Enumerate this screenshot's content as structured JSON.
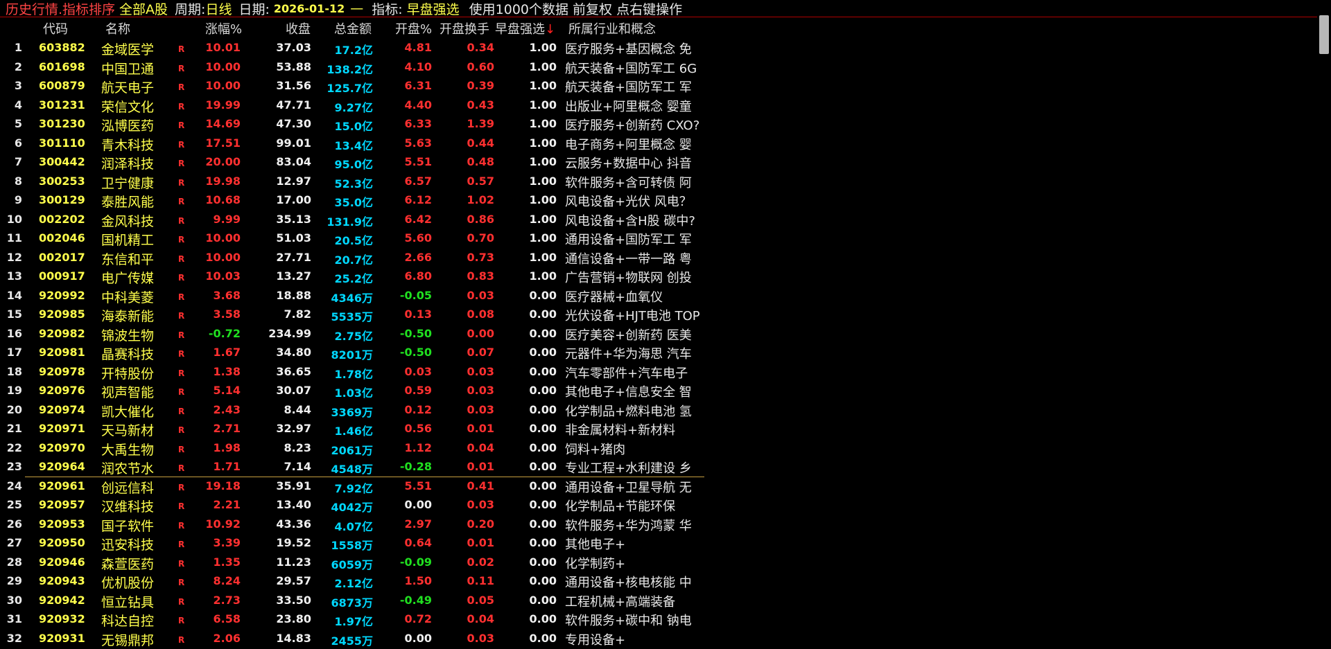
{
  "titlebar": {
    "title": "历史行情.指标排序",
    "market": "全部A股",
    "period_label": "周期:",
    "period": "日线",
    "date_label": "日期:",
    "date": "2026-01-12",
    "dash": "—",
    "indicator_label": "指标:",
    "indicator": "早盘强选",
    "note": "使用1000个数据 前复权 点右键操作"
  },
  "columns": {
    "code": "代码",
    "name": "名称",
    "chg": "涨幅%",
    "close": "收盘",
    "amount": "总金额",
    "open": "开盘%",
    "turnover": "开盘换手",
    "early": "早盘强选",
    "sort_arrow": "↓",
    "industry": "所属行业和概念"
  },
  "colors": {
    "up": "#ff3030",
    "down": "#20e020",
    "flat": "#f0f0f0",
    "code": "#ffff4c",
    "amount": "#00d8ff"
  },
  "rows": [
    {
      "idx": "1",
      "code": "603882",
      "name": "金域医学",
      "r": "R",
      "chg": "10.01",
      "chg_dir": "up",
      "close": "37.03",
      "amount": "17.2亿",
      "open": "4.81",
      "open_dir": "up",
      "turnover": "0.34",
      "early": "1.00",
      "industry": "医疗服务+基因概念 免"
    },
    {
      "idx": "2",
      "code": "601698",
      "name": "中国卫通",
      "r": "R",
      "chg": "10.00",
      "chg_dir": "up",
      "close": "53.88",
      "amount": "138.2亿",
      "open": "4.10",
      "open_dir": "up",
      "turnover": "0.60",
      "early": "1.00",
      "industry": "航天装备+国防军工 6G"
    },
    {
      "idx": "3",
      "code": "600879",
      "name": "航天电子",
      "r": "R",
      "chg": "10.00",
      "chg_dir": "up",
      "close": "31.56",
      "amount": "125.7亿",
      "open": "6.31",
      "open_dir": "up",
      "turnover": "0.39",
      "early": "1.00",
      "industry": "航天装备+国防军工 军"
    },
    {
      "idx": "4",
      "code": "301231",
      "name": "荣信文化",
      "r": "R",
      "chg": "19.99",
      "chg_dir": "up",
      "close": "47.71",
      "amount": "9.27亿",
      "open": "4.40",
      "open_dir": "up",
      "turnover": "0.43",
      "early": "1.00",
      "industry": "出版业+阿里概念 婴童"
    },
    {
      "idx": "5",
      "code": "301230",
      "name": "泓博医药",
      "r": "R",
      "chg": "14.69",
      "chg_dir": "up",
      "close": "47.30",
      "amount": "15.0亿",
      "open": "6.33",
      "open_dir": "up",
      "turnover": "1.39",
      "early": "1.00",
      "industry": "医疗服务+创新药 CXO?"
    },
    {
      "idx": "6",
      "code": "301110",
      "name": "青木科技",
      "r": "R",
      "chg": "17.51",
      "chg_dir": "up",
      "close": "99.01",
      "amount": "13.4亿",
      "open": "5.63",
      "open_dir": "up",
      "turnover": "0.44",
      "early": "1.00",
      "industry": "电子商务+阿里概念 婴"
    },
    {
      "idx": "7",
      "code": "300442",
      "name": "润泽科技",
      "r": "R",
      "chg": "20.00",
      "chg_dir": "up",
      "close": "83.04",
      "amount": "95.0亿",
      "open": "5.51",
      "open_dir": "up",
      "turnover": "0.48",
      "early": "1.00",
      "industry": "云服务+数据中心 抖音"
    },
    {
      "idx": "8",
      "code": "300253",
      "name": "卫宁健康",
      "r": "R",
      "chg": "19.98",
      "chg_dir": "up",
      "close": "12.97",
      "amount": "52.3亿",
      "open": "6.57",
      "open_dir": "up",
      "turnover": "0.57",
      "early": "1.00",
      "industry": "软件服务+含可转债 阿"
    },
    {
      "idx": "9",
      "code": "300129",
      "name": "泰胜风能",
      "r": "R",
      "chg": "10.68",
      "chg_dir": "up",
      "close": "17.00",
      "amount": "35.0亿",
      "open": "6.12",
      "open_dir": "up",
      "turnover": "1.02",
      "early": "1.00",
      "industry": "风电设备+光伏 风电？"
    },
    {
      "idx": "10",
      "code": "002202",
      "name": "金风科技",
      "r": "R",
      "chg": "9.99",
      "chg_dir": "up",
      "close": "35.13",
      "amount": "131.9亿",
      "open": "6.42",
      "open_dir": "up",
      "turnover": "0.86",
      "early": "1.00",
      "industry": "风电设备+含H股 碳中?"
    },
    {
      "idx": "11",
      "code": "002046",
      "name": "国机精工",
      "r": "R",
      "chg": "10.00",
      "chg_dir": "up",
      "close": "51.03",
      "amount": "20.5亿",
      "open": "5.60",
      "open_dir": "up",
      "turnover": "0.70",
      "early": "1.00",
      "industry": "通用设备+国防军工 军"
    },
    {
      "idx": "12",
      "code": "002017",
      "name": "东信和平",
      "r": "R",
      "chg": "10.00",
      "chg_dir": "up",
      "close": "27.71",
      "amount": "20.7亿",
      "open": "2.66",
      "open_dir": "up",
      "turnover": "0.73",
      "early": "1.00",
      "industry": "通信设备+一带一路 粤"
    },
    {
      "idx": "13",
      "code": "000917",
      "name": "电广传媒",
      "r": "R",
      "chg": "10.03",
      "chg_dir": "up",
      "close": "13.27",
      "amount": "25.2亿",
      "open": "6.80",
      "open_dir": "up",
      "turnover": "0.83",
      "early": "1.00",
      "industry": "广告营销+物联网 创投"
    },
    {
      "idx": "14",
      "code": "920992",
      "name": "中科美菱",
      "r": "R",
      "chg": "3.68",
      "chg_dir": "up",
      "close": "18.88",
      "amount": "4346万",
      "open": "-0.05",
      "open_dir": "down",
      "turnover": "0.03",
      "early": "0.00",
      "industry": "医疗器械+血氧仪"
    },
    {
      "idx": "15",
      "code": "920985",
      "name": "海泰新能",
      "r": "R",
      "chg": "3.58",
      "chg_dir": "up",
      "close": "7.82",
      "amount": "5535万",
      "open": "0.13",
      "open_dir": "up",
      "turnover": "0.08",
      "early": "0.00",
      "industry": "光伏设备+HJT电池 TOP"
    },
    {
      "idx": "16",
      "code": "920982",
      "name": "锦波生物",
      "r": "R",
      "chg": "-0.72",
      "chg_dir": "down",
      "close": "234.99",
      "amount": "2.75亿",
      "open": "-0.50",
      "open_dir": "down",
      "turnover": "0.00",
      "early": "0.00",
      "industry": "医疗美容+创新药 医美"
    },
    {
      "idx": "17",
      "code": "920981",
      "name": "晶赛科技",
      "r": "R",
      "chg": "1.67",
      "chg_dir": "up",
      "close": "34.80",
      "amount": "8201万",
      "open": "-0.50",
      "open_dir": "down",
      "turnover": "0.07",
      "early": "0.00",
      "industry": "元器件+华为海思 汽车"
    },
    {
      "idx": "18",
      "code": "920978",
      "name": "开特股份",
      "r": "R",
      "chg": "1.38",
      "chg_dir": "up",
      "close": "36.65",
      "amount": "1.78亿",
      "open": "0.03",
      "open_dir": "up",
      "turnover": "0.03",
      "early": "0.00",
      "industry": "汽车零部件+汽车电子"
    },
    {
      "idx": "19",
      "code": "920976",
      "name": "视声智能",
      "r": "R",
      "chg": "5.14",
      "chg_dir": "up",
      "close": "30.07",
      "amount": "1.03亿",
      "open": "0.59",
      "open_dir": "up",
      "turnover": "0.03",
      "early": "0.00",
      "industry": "其他电子+信息安全 智"
    },
    {
      "idx": "20",
      "code": "920974",
      "name": "凯大催化",
      "r": "R",
      "chg": "2.43",
      "chg_dir": "up",
      "close": "8.44",
      "amount": "3369万",
      "open": "0.12",
      "open_dir": "up",
      "turnover": "0.03",
      "early": "0.00",
      "industry": "化学制品+燃料电池 氢"
    },
    {
      "idx": "21",
      "code": "920971",
      "name": "天马新材",
      "r": "R",
      "chg": "2.71",
      "chg_dir": "up",
      "close": "32.97",
      "amount": "1.46亿",
      "open": "0.56",
      "open_dir": "up",
      "turnover": "0.01",
      "early": "0.00",
      "industry": "非金属材料+新材料"
    },
    {
      "idx": "22",
      "code": "920970",
      "name": "大禹生物",
      "r": "R",
      "chg": "1.98",
      "chg_dir": "up",
      "close": "8.23",
      "amount": "2061万",
      "open": "1.12",
      "open_dir": "up",
      "turnover": "0.04",
      "early": "0.00",
      "industry": "饲料+猪肉"
    },
    {
      "idx": "23",
      "code": "920964",
      "name": "润农节水",
      "r": "R",
      "chg": "1.71",
      "chg_dir": "up",
      "close": "7.14",
      "amount": "4548万",
      "open": "-0.28",
      "open_dir": "down",
      "turnover": "0.01",
      "early": "0.00",
      "industry": "专业工程+水利建设 乡"
    },
    {
      "idx": "24",
      "code": "920961",
      "name": "创远信科",
      "r": "R",
      "chg": "19.18",
      "chg_dir": "up",
      "close": "35.91",
      "amount": "7.92亿",
      "open": "5.51",
      "open_dir": "up",
      "turnover": "0.41",
      "early": "0.00",
      "industry": "通用设备+卫星导航 无"
    },
    {
      "idx": "25",
      "code": "920957",
      "name": "汉维科技",
      "r": "R",
      "chg": "2.21",
      "chg_dir": "up",
      "close": "13.40",
      "amount": "4042万",
      "open": "0.00",
      "open_dir": "flat",
      "turnover": "0.03",
      "early": "0.00",
      "industry": "化学制品+节能环保"
    },
    {
      "idx": "26",
      "code": "920953",
      "name": "国子软件",
      "r": "R",
      "chg": "10.92",
      "chg_dir": "up",
      "close": "43.36",
      "amount": "4.07亿",
      "open": "2.97",
      "open_dir": "up",
      "turnover": "0.20",
      "early": "0.00",
      "industry": "软件服务+华为鸿蒙 华"
    },
    {
      "idx": "27",
      "code": "920950",
      "name": "迅安科技",
      "r": "R",
      "chg": "3.39",
      "chg_dir": "up",
      "close": "19.52",
      "amount": "1558万",
      "open": "0.64",
      "open_dir": "up",
      "turnover": "0.01",
      "early": "0.00",
      "industry": "其他电子+"
    },
    {
      "idx": "28",
      "code": "920946",
      "name": "森萱医药",
      "r": "R",
      "chg": "1.35",
      "chg_dir": "up",
      "close": "11.23",
      "amount": "6059万",
      "open": "-0.09",
      "open_dir": "down",
      "turnover": "0.02",
      "early": "0.00",
      "industry": "化学制药+"
    },
    {
      "idx": "29",
      "code": "920943",
      "name": "优机股份",
      "r": "R",
      "chg": "8.24",
      "chg_dir": "up",
      "close": "29.57",
      "amount": "2.12亿",
      "open": "1.50",
      "open_dir": "up",
      "turnover": "0.11",
      "early": "0.00",
      "industry": "通用设备+核电核能 中"
    },
    {
      "idx": "30",
      "code": "920942",
      "name": "恒立钻具",
      "r": "R",
      "chg": "2.73",
      "chg_dir": "up",
      "close": "33.50",
      "amount": "6873万",
      "open": "-0.49",
      "open_dir": "down",
      "turnover": "0.05",
      "early": "0.00",
      "industry": "工程机械+高端装备"
    },
    {
      "idx": "31",
      "code": "920932",
      "name": "科达自控",
      "r": "R",
      "chg": "6.58",
      "chg_dir": "up",
      "close": "23.80",
      "amount": "1.97亿",
      "open": "0.72",
      "open_dir": "up",
      "turnover": "0.04",
      "early": "0.00",
      "industry": "软件服务+碳中和 钠电"
    },
    {
      "idx": "32",
      "code": "920931",
      "name": "无锡鼎邦",
      "r": "R",
      "chg": "2.06",
      "chg_dir": "up",
      "close": "14.83",
      "amount": "2455万",
      "open": "0.00",
      "open_dir": "flat",
      "turnover": "0.03",
      "early": "0.00",
      "industry": "专用设备+"
    }
  ]
}
